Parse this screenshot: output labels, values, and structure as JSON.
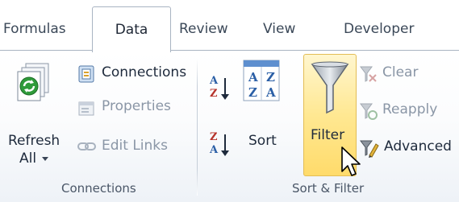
{
  "tabs": [
    {
      "label": "Formulas"
    },
    {
      "label": "Data"
    },
    {
      "label": "Review"
    },
    {
      "label": "View"
    },
    {
      "label": "Developer"
    }
  ],
  "active_tab": "Data",
  "groups": {
    "connections": {
      "label": "Connections",
      "refresh_line1": "Refresh",
      "refresh_line2": "All",
      "connections_label": "Connections",
      "properties_label": "Properties",
      "edit_links_label": "Edit Links"
    },
    "sort_filter": {
      "label": "Sort & Filter",
      "sort_asc_icon_top": "A",
      "sort_asc_icon_bottom": "Z",
      "sort_desc_icon_top": "Z",
      "sort_desc_icon_bottom": "A",
      "sort_label": "Sort",
      "filter_label": "Filter",
      "clear_label": "Clear",
      "reapply_label": "Reapply",
      "advanced_label": "Advanced"
    }
  },
  "colors": {
    "filter_highlight": "#ffe892",
    "refresh_green": "#2f9b3a",
    "funnel": "#7d8590",
    "disabled_text": "#8a96a6"
  }
}
